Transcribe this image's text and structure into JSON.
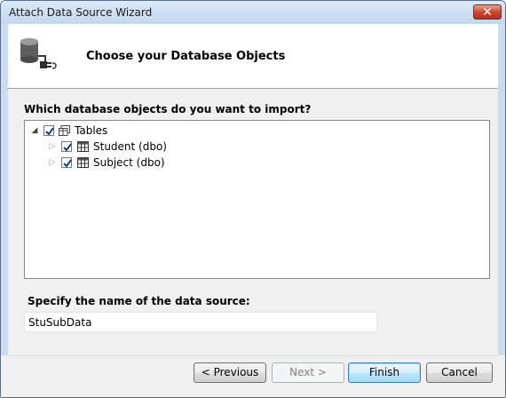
{
  "window": {
    "title": "Attach Data Source Wizard",
    "close_glyph": "✕"
  },
  "header": {
    "title": "Choose your Database Objects",
    "icon": "database-connection-icon"
  },
  "main": {
    "question": "Which database objects do you want to import?",
    "tree": {
      "root": {
        "label": "Tables",
        "checked": true,
        "expanded": true,
        "icon": "tables-icon"
      },
      "children": [
        {
          "label": "Student (dbo)",
          "checked": true,
          "expanded": false,
          "icon": "table-icon"
        },
        {
          "label": "Subject (dbo)",
          "checked": true,
          "expanded": false,
          "icon": "table-icon"
        }
      ]
    },
    "datasource_label": "Specify the name of the data source:",
    "datasource_value": "StuSubData"
  },
  "buttons": {
    "previous": "< Previous",
    "next": "Next >",
    "finish": "Finish",
    "cancel": "Cancel"
  },
  "colors": {
    "title_bar": "#c9dcf1",
    "close_button": "#c9432c",
    "default_button_border": "#3c7fb1"
  }
}
